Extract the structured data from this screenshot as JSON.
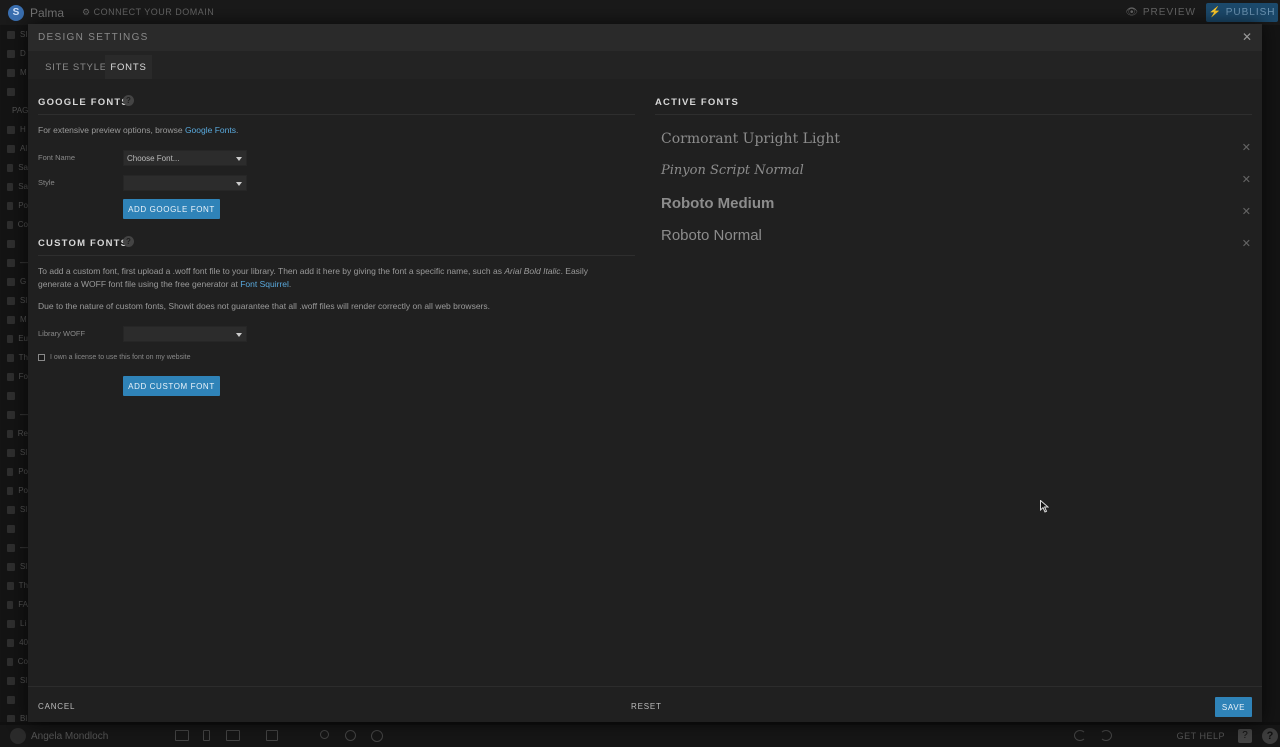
{
  "app": {
    "site_name": "Palma",
    "connect_domain": "⚙ CONNECT YOUR DOMAIN",
    "preview": "👁 PREVIEW",
    "publish": "⚡ PUBLISH",
    "user": "Angela Mondloch",
    "get_help": "GET HELP",
    "help_badge": "?",
    "help_circle": "?",
    "left_rows": [
      "SI",
      "D",
      "M",
      "",
      "PAGE",
      "H",
      "Al",
      "Sa",
      "Sa",
      "Po",
      "Co",
      "",
      "—",
      "G",
      "Sl",
      "M",
      "Eu",
      "Th",
      "Fo",
      "",
      "—",
      "Re",
      "Sl",
      "Po",
      "Po",
      "Sl",
      "",
      "—",
      "Sl",
      "Th",
      "FA",
      "Li",
      "40",
      "Co",
      "Sl",
      "",
      "Bl",
      "Bl"
    ]
  },
  "modal": {
    "title": "DESIGN SETTINGS",
    "close": "✕",
    "tabs": [
      {
        "label": "SITE STYLE"
      },
      {
        "label": "FONTS"
      }
    ],
    "google": {
      "title": "GOOGLE FONTS",
      "help": "?",
      "intro": "For extensive preview options, browse ",
      "intro_link": "Google Fonts",
      "intro_end": ".",
      "font_name_label": "Font Name",
      "font_name_value": "Choose Font...",
      "style_label": "Style",
      "style_value": "",
      "add_button": "ADD GOOGLE FONT"
    },
    "custom": {
      "title": "CUSTOM FONTS",
      "help": "?",
      "p1_a": "To add a custom font, first upload a .woff font file to your library. Then add it here by giving the font a specific name, such as ",
      "p1_em": "Arial Bold Italic",
      "p1_b": ". Easily",
      "p1_line2": "generate a WOFF font file using the free generator at ",
      "p1_link": "Font Squirrel",
      "p1_end": ".",
      "p2": "Due to the nature of custom fonts, Showit does not guarantee that all .woff files will render correctly on all web browsers.",
      "library_label": "Library WOFF",
      "library_value": "",
      "license_label": "I own a license to use this font on my website",
      "add_button": "ADD CUSTOM FONT"
    },
    "active": {
      "title": "ACTIVE FONTS",
      "fonts": [
        {
          "name": "Cormorant Upright Light",
          "remove": "✕"
        },
        {
          "name": "Pinyon Script Normal",
          "remove": "✕"
        },
        {
          "name": "Roboto Medium",
          "remove": "✕"
        },
        {
          "name": "Roboto Normal",
          "remove": "✕"
        }
      ]
    },
    "footer": {
      "cancel": "CANCEL",
      "reset": "RESET",
      "save": "SAVE"
    }
  },
  "colors": {
    "accent": "#2f83b8",
    "link": "#59a9dd",
    "modal_bg": "#202020"
  }
}
